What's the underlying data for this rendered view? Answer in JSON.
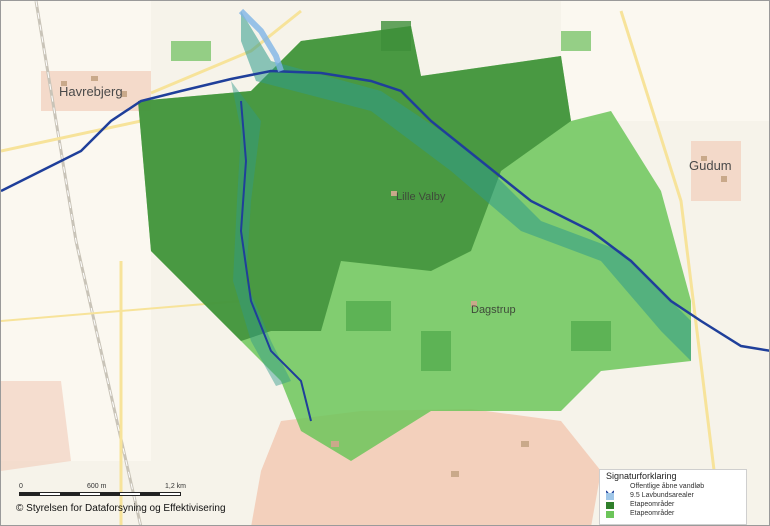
{
  "map": {
    "places": {
      "havrebjerg": "Havrebjerg",
      "gudum": "Gudum",
      "lille_valby": "Lille Valby",
      "dagstrup": "Dagstrup"
    },
    "colors": {
      "background": "#f6f3ea",
      "etape_dark": "#3f8f3a",
      "etape_mid": "#58b04f",
      "etape_light": "#8ed37a",
      "lavbund": "#2f9a8a",
      "water": "#1f3f9a",
      "town": "#f2c9b4"
    }
  },
  "legend": {
    "title": "Signaturforklaring",
    "items": [
      {
        "label": "Offentlige åbne vandløb",
        "color": "#1f3f9a",
        "icon": "watercourse-icon"
      },
      {
        "label": "9.5 Lavbundsarealer",
        "color": "#9fc6e8"
      },
      {
        "label": "Etapeområder",
        "color": "#2f7f2a"
      },
      {
        "label": "Etapeområder",
        "color": "#6cc55a"
      }
    ]
  },
  "scale": {
    "start": "0",
    "middle": "600 m",
    "end": "1,2 km"
  },
  "credit": "© Styrelsen for Dataforsyning og Effektivisering"
}
